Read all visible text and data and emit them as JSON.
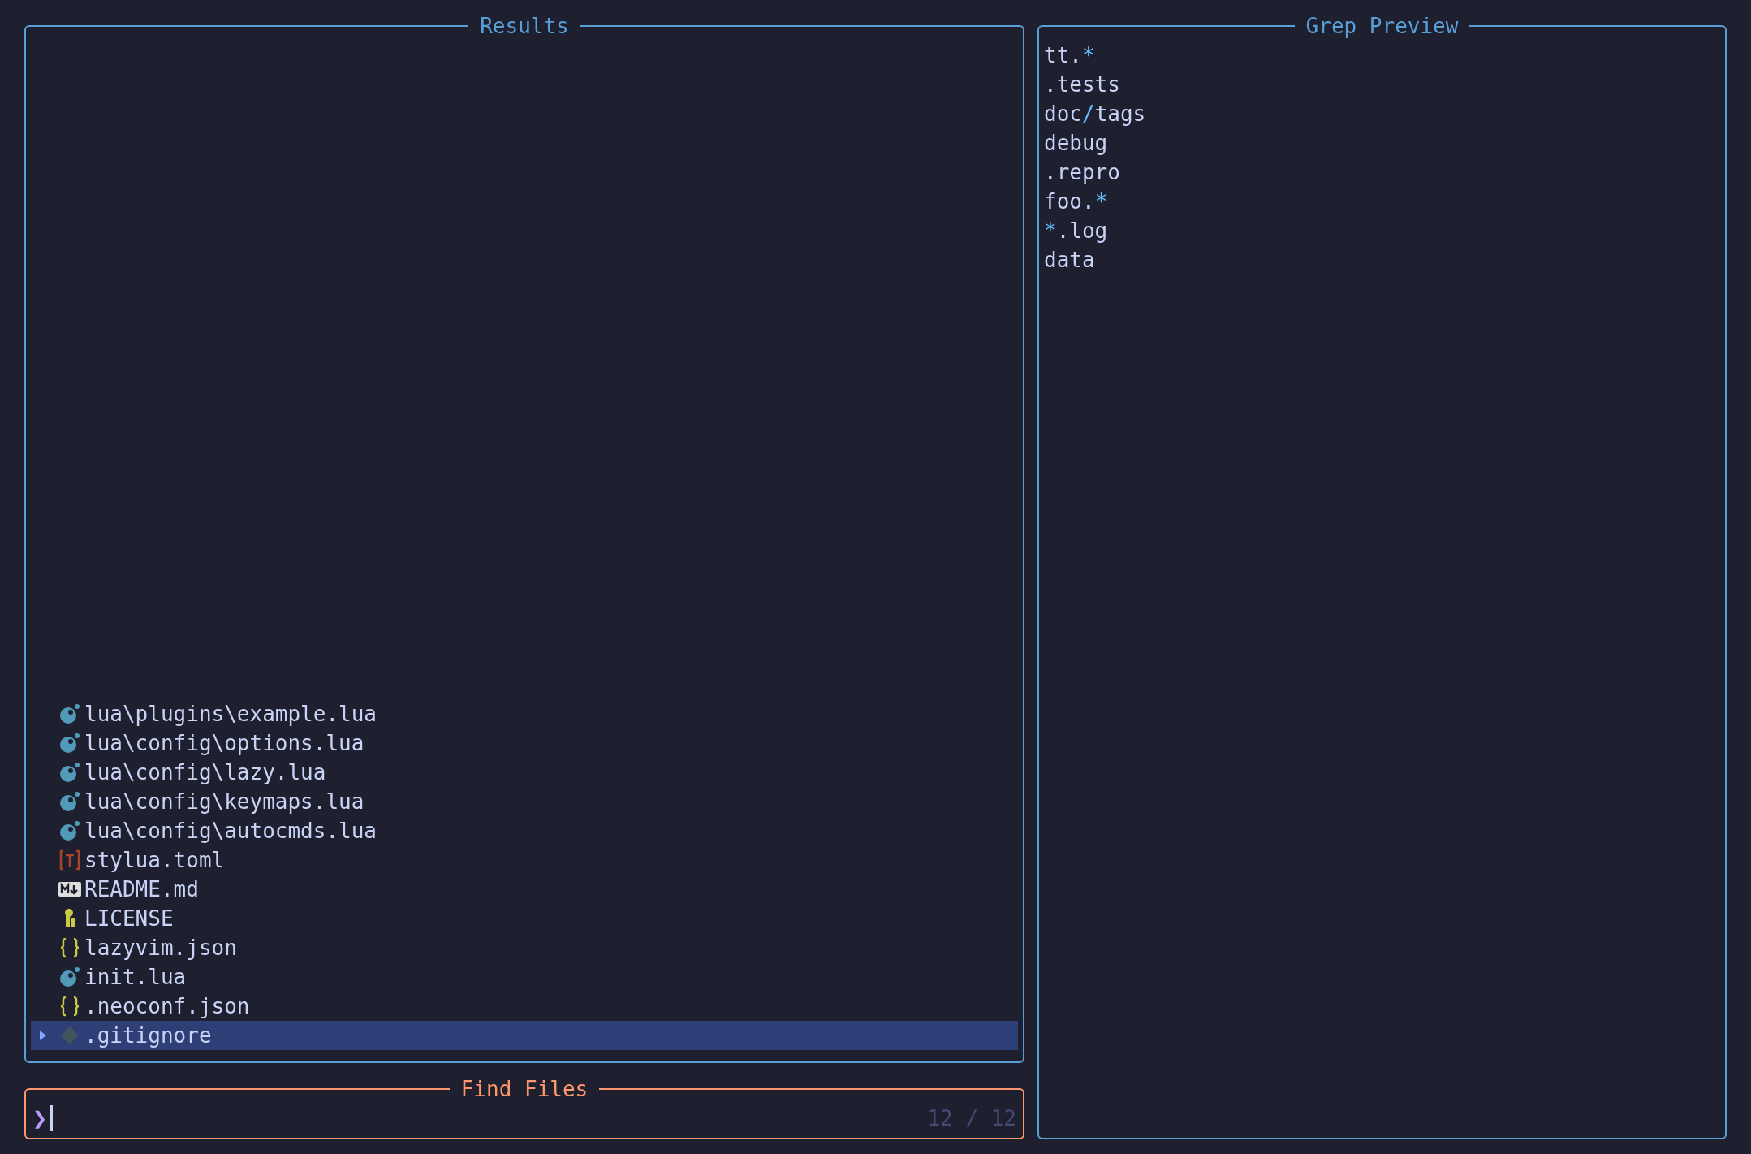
{
  "results": {
    "title": "Results",
    "files": [
      {
        "name": "lua\\plugins\\example.lua",
        "kind": "lua",
        "selected": false
      },
      {
        "name": "lua\\config\\options.lua",
        "kind": "lua",
        "selected": false
      },
      {
        "name": "lua\\config\\lazy.lua",
        "kind": "lua",
        "selected": false
      },
      {
        "name": "lua\\config\\keymaps.lua",
        "kind": "lua",
        "selected": false
      },
      {
        "name": "lua\\config\\autocmds.lua",
        "kind": "lua",
        "selected": false
      },
      {
        "name": "stylua.toml",
        "kind": "toml",
        "selected": false
      },
      {
        "name": "README.md",
        "kind": "markdown",
        "selected": false
      },
      {
        "name": "LICENSE",
        "kind": "license",
        "selected": false
      },
      {
        "name": "lazyvim.json",
        "kind": "json",
        "selected": false
      },
      {
        "name": "init.lua",
        "kind": "lua",
        "selected": false
      },
      {
        "name": ".neoconf.json",
        "kind": "json",
        "selected": false
      },
      {
        "name": ".gitignore",
        "kind": "git",
        "selected": true
      }
    ]
  },
  "prompt": {
    "title": "Find Files",
    "prompt_symbol": "❯",
    "count": "12 / 12"
  },
  "preview": {
    "title": "Grep Preview",
    "lines": [
      [
        {
          "text": "tt.",
          "kind": "plain"
        },
        {
          "text": "*",
          "kind": "special"
        }
      ],
      [
        {
          "text": ".tests",
          "kind": "plain"
        }
      ],
      [
        {
          "text": "doc",
          "kind": "plain"
        },
        {
          "text": "/",
          "kind": "special"
        },
        {
          "text": "tags",
          "kind": "plain"
        }
      ],
      [
        {
          "text": "debug",
          "kind": "plain"
        }
      ],
      [
        {
          "text": ".repro",
          "kind": "plain"
        }
      ],
      [
        {
          "text": "foo.",
          "kind": "plain"
        },
        {
          "text": "*",
          "kind": "special"
        }
      ],
      [
        {
          "text": "*",
          "kind": "special"
        },
        {
          "text": ".log",
          "kind": "plain"
        }
      ],
      [
        {
          "text": "data",
          "kind": "plain"
        }
      ]
    ]
  }
}
